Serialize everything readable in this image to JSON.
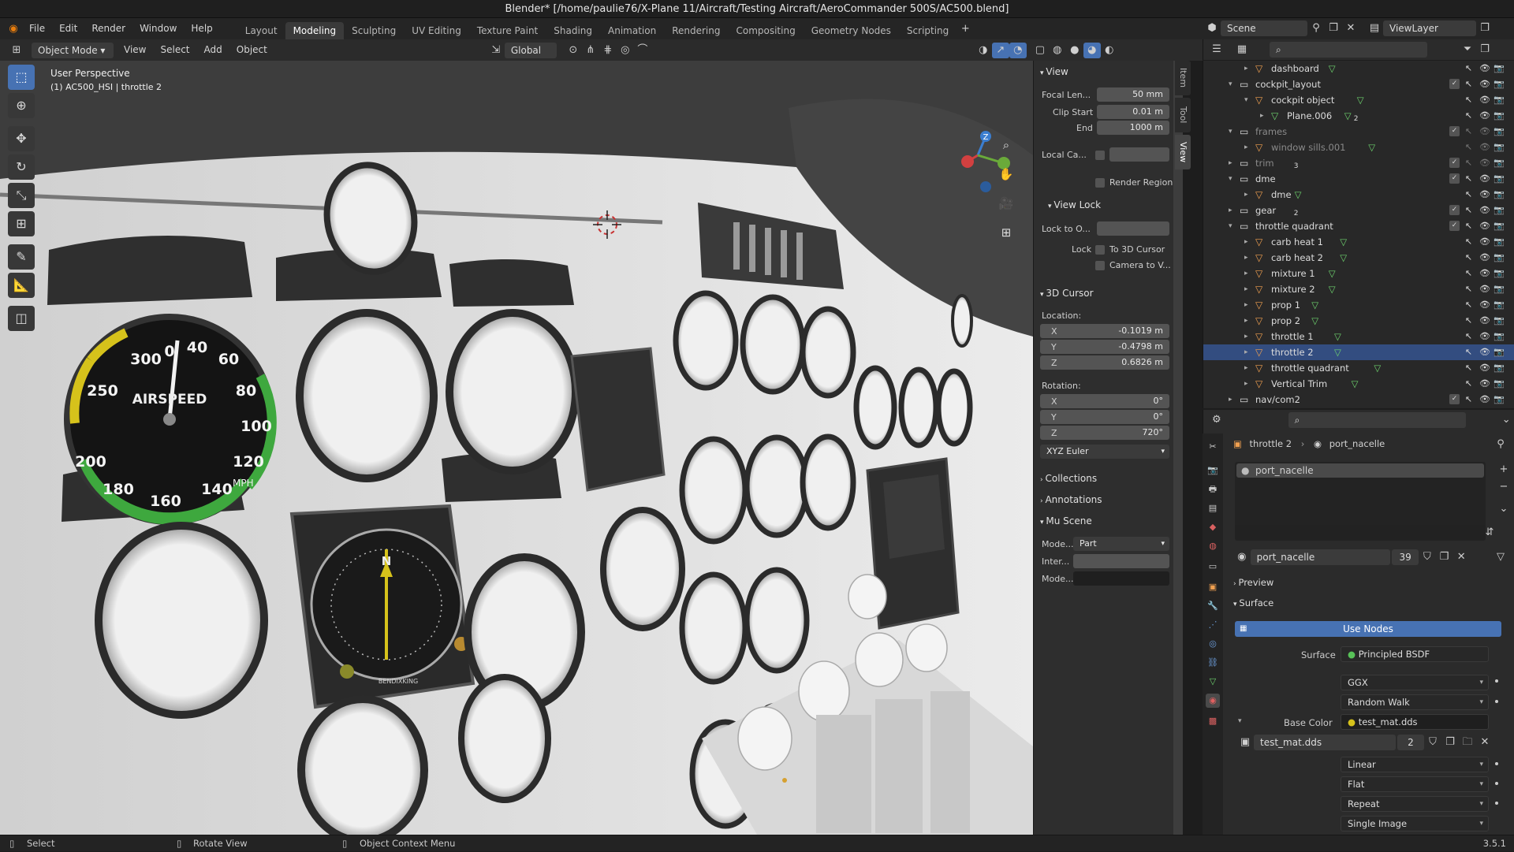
{
  "window": {
    "title": "Blender* [/home/paulie76/X-Plane 11/Aircraft/Testing Aircraft/AeroCommander 500S/AC500.blend]"
  },
  "menu": [
    "File",
    "Edit",
    "Render",
    "Window",
    "Help"
  ],
  "workspaces": [
    {
      "label": "Layout"
    },
    {
      "label": "Modeling",
      "active": true
    },
    {
      "label": "Sculpting"
    },
    {
      "label": "UV Editing"
    },
    {
      "label": "Texture Paint"
    },
    {
      "label": "Shading"
    },
    {
      "label": "Animation"
    },
    {
      "label": "Rendering"
    },
    {
      "label": "Compositing"
    },
    {
      "label": "Geometry Nodes"
    },
    {
      "label": "Scripting"
    }
  ],
  "scene": {
    "label": "Scene",
    "view_layer": "ViewLayer"
  },
  "viewport_header": {
    "mode": "Object Mode",
    "menus": [
      "View",
      "Select",
      "Add",
      "Object"
    ],
    "orientation": "Global"
  },
  "viewport": {
    "overlay_title": "User Perspective",
    "overlay_object": "(1) AC500_HSI | throttle 2",
    "gizmo_z": "Z"
  },
  "instrument": {
    "airspeed_label": "AIRSPEED",
    "mph_label": "MPH",
    "ticks": [
      "0",
      "40",
      "60",
      "80",
      "100",
      "120",
      "140",
      "160",
      "180",
      "200",
      "250",
      "300"
    ],
    "hsi_n": "N",
    "hsi_brand": "BENDIXKING"
  },
  "npanel": {
    "tabs": [
      "Item",
      "Tool",
      "View"
    ],
    "view_section": "View",
    "focal_label": "Focal Len...",
    "focal_value": "50 mm",
    "clip_start_label": "Clip Start",
    "clip_start_value": "0.01 m",
    "clip_end_label": "End",
    "clip_end_value": "1000 m",
    "local_cam_label": "Local Ca...",
    "render_region": "Render Region",
    "view_lock_section": "View Lock",
    "lock_obj_label": "Lock to O...",
    "lock_label": "Lock",
    "to_cursor": "To 3D Cursor",
    "camera_view": "Camera to V...",
    "cursor_section": "3D Cursor",
    "location_label": "Location:",
    "loc": [
      {
        "axis": "X",
        "value": "-0.1019 m"
      },
      {
        "axis": "Y",
        "value": "-0.4798 m"
      },
      {
        "axis": "Z",
        "value": "0.6826 m"
      }
    ],
    "rotation_label": "Rotation:",
    "rot": [
      {
        "axis": "X",
        "value": "0°"
      },
      {
        "axis": "Y",
        "value": "0°"
      },
      {
        "axis": "Z",
        "value": "720°"
      }
    ],
    "rotation_mode": "XYZ Euler",
    "collections": "Collections",
    "annotations": "Annotations",
    "mu_scene": "Mu Scene",
    "mode_label": "Mode...",
    "mode_value": "Part",
    "inter_label": "Inter...",
    "mode2_label": "Mode..."
  },
  "outliner": {
    "rows": [
      {
        "name": "dashboard",
        "depth": 2,
        "type": "object",
        "sub": "",
        "expanded": false
      },
      {
        "name": "cockpit_layout",
        "depth": 1,
        "type": "collection",
        "sub": "",
        "expanded": true
      },
      {
        "name": "cockpit object",
        "depth": 2,
        "type": "object",
        "sub": "",
        "expanded": true
      },
      {
        "name": "Plane.006",
        "depth": 3,
        "type": "mesh",
        "sub": "2",
        "expanded": false
      },
      {
        "name": "frames",
        "depth": 1,
        "type": "collection",
        "sub": "",
        "expanded": true,
        "dim": true
      },
      {
        "name": "window sills.001",
        "depth": 2,
        "type": "object",
        "sub": "",
        "expanded": false,
        "dim": true
      },
      {
        "name": "trim",
        "depth": 1,
        "type": "collection",
        "sub": "3",
        "expanded": false,
        "dim": true
      },
      {
        "name": "dme",
        "depth": 1,
        "type": "collection",
        "sub": "",
        "expanded": true
      },
      {
        "name": "dme",
        "depth": 2,
        "type": "object",
        "sub": "",
        "expanded": false
      },
      {
        "name": "gear",
        "depth": 1,
        "type": "collection",
        "sub": "2",
        "expanded": false
      },
      {
        "name": "throttle quadrant",
        "depth": 1,
        "type": "collection",
        "sub": "",
        "expanded": true
      },
      {
        "name": "carb heat 1",
        "depth": 2,
        "type": "object",
        "sub": "",
        "expanded": false
      },
      {
        "name": "carb heat 2",
        "depth": 2,
        "type": "object",
        "sub": "",
        "expanded": false
      },
      {
        "name": "mixture 1",
        "depth": 2,
        "type": "object",
        "sub": "",
        "expanded": false
      },
      {
        "name": "mixture 2",
        "depth": 2,
        "type": "object",
        "sub": "",
        "expanded": false
      },
      {
        "name": "prop 1",
        "depth": 2,
        "type": "object",
        "sub": "",
        "expanded": false
      },
      {
        "name": "prop 2",
        "depth": 2,
        "type": "object",
        "sub": "",
        "expanded": false
      },
      {
        "name": "throttle 1",
        "depth": 2,
        "type": "object",
        "sub": "",
        "expanded": false
      },
      {
        "name": "throttle 2",
        "depth": 2,
        "type": "object",
        "sub": "",
        "expanded": false,
        "selected": true
      },
      {
        "name": "throttle quadrant",
        "depth": 2,
        "type": "object",
        "sub": "",
        "expanded": false
      },
      {
        "name": "Vertical Trim",
        "depth": 2,
        "type": "object",
        "sub": "",
        "expanded": false
      },
      {
        "name": "nav/com2",
        "depth": 1,
        "type": "collection",
        "sub": "",
        "expanded": false
      }
    ]
  },
  "properties": {
    "breadcrumb_obj": "throttle 2",
    "breadcrumb_mat": "port_nacelle",
    "slot_name": "port_nacelle",
    "material_name": "port_nacelle",
    "material_users": "39",
    "preview": "Preview",
    "surface_section": "Surface",
    "use_nodes": "Use Nodes",
    "surface_label": "Surface",
    "surface_value": "Principled BSDF",
    "dist": "GGX",
    "sss": "Random Walk",
    "base_color_label": "Base Color",
    "base_color_value": "test_mat.dds",
    "image_name": "test_mat.dds",
    "image_users": "2",
    "interp": "Linear",
    "proj": "Flat",
    "ext": "Repeat",
    "source": "Single Image"
  },
  "status": {
    "select": "Select",
    "rotate": "Rotate View",
    "context": "Object Context Menu",
    "version": "3.5.1"
  },
  "colors": {
    "accent": "#4772b3",
    "selected_row": "#334d80",
    "object_icon": "#f0a050",
    "mesh_icon": "#6ed36e"
  }
}
